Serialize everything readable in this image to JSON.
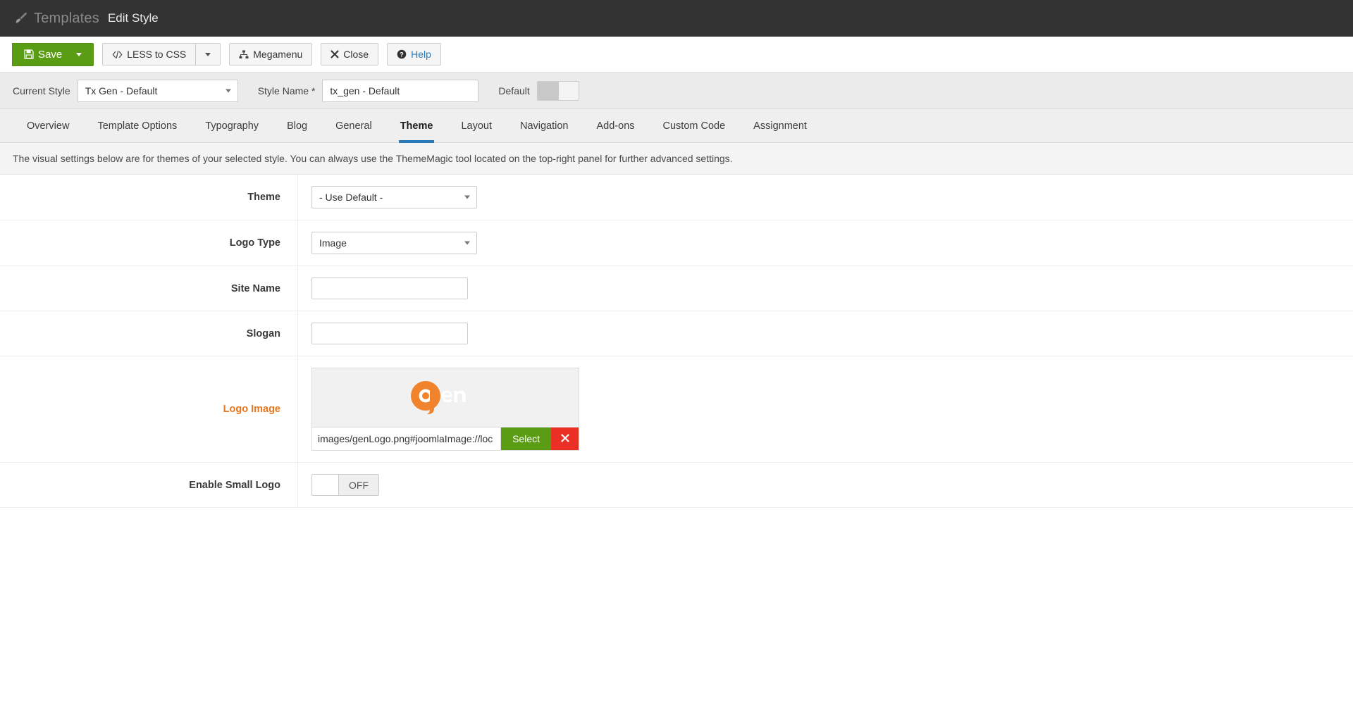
{
  "header": {
    "module_title": "Templates",
    "page_title": "Edit Style",
    "brush_icon": "paintbrush-icon"
  },
  "toolbar": {
    "save_label": "Save",
    "save_icon": "floppy-disk-icon",
    "save_dropdown_icon": "caret-down-icon",
    "less_to_css_label": "LESS to CSS",
    "less_to_css_icon": "code-brackets-icon",
    "less_dropdown_icon": "caret-down-icon",
    "megamenu_label": "Megamenu",
    "megamenu_icon": "sitemap-icon",
    "close_label": "Close",
    "close_icon": "x-mark-icon",
    "help_label": "Help",
    "help_icon": "question-circle-icon"
  },
  "stylebar": {
    "current_style_label": "Current Style",
    "current_style_value": "Tx Gen - Default",
    "style_name_label": "Style Name *",
    "style_name_value": "tx_gen - Default",
    "style_name_placeholder": "",
    "default_label": "Default",
    "default_state": "on"
  },
  "tabs": [
    {
      "label": "Overview",
      "active": false
    },
    {
      "label": "Template Options",
      "active": false
    },
    {
      "label": "Typography",
      "active": false
    },
    {
      "label": "Blog",
      "active": false
    },
    {
      "label": "General",
      "active": false
    },
    {
      "label": "Theme",
      "active": true
    },
    {
      "label": "Layout",
      "active": false
    },
    {
      "label": "Navigation",
      "active": false
    },
    {
      "label": "Add-ons",
      "active": false
    },
    {
      "label": "Custom Code",
      "active": false
    },
    {
      "label": "Assignment",
      "active": false
    }
  ],
  "description": "The visual settings below are for themes of your selected style. You can always use the ThemeMagic tool located on the top-right panel for further advanced settings.",
  "fields": {
    "theme": {
      "label": "Theme",
      "value": "- Use Default -"
    },
    "logo_type": {
      "label": "Logo Type",
      "value": "Image"
    },
    "site_name": {
      "label": "Site Name",
      "value": "",
      "placeholder": ""
    },
    "slogan": {
      "label": "Slogan",
      "value": "",
      "placeholder": ""
    },
    "logo_image": {
      "label": "Logo Image",
      "path_value": "images/genLogo.png#joomlaImage://loc",
      "path_placeholder": "",
      "select_label": "Select",
      "clear_icon": "x-mark-icon",
      "preview_alt": "gen-logo-image"
    },
    "enable_small_logo": {
      "label": "Enable Small Logo",
      "state_label": "OFF"
    }
  },
  "colors": {
    "accent_orange": "#e8761c",
    "green": "#5a9d15",
    "red": "#ea2f25",
    "blue": "#2a7ab9",
    "header_dark": "#333333"
  }
}
